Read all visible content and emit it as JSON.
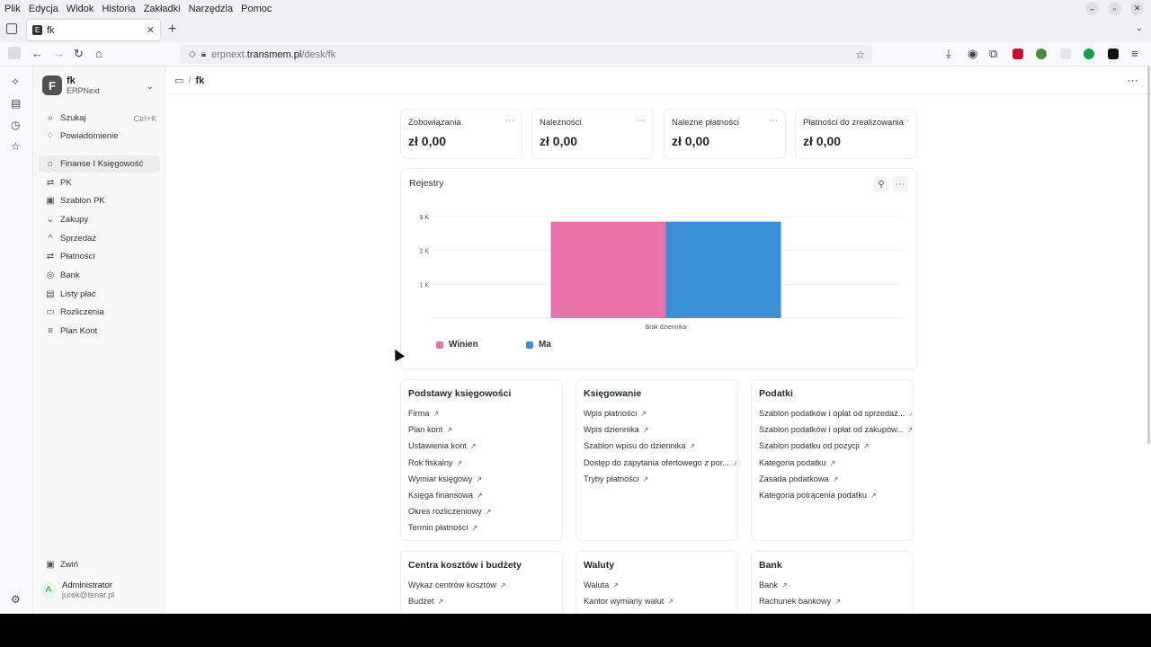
{
  "menubar": [
    "Plik",
    "Edycja",
    "Widok",
    "Historia",
    "Zakładki",
    "Narzędzia",
    "Pomoc"
  ],
  "browser": {
    "tab_title": "fk",
    "url_prefix": "erpnext.",
    "url_domain": "transmem.pl",
    "url_path": "/desk/fk"
  },
  "sidebar": {
    "workspace_name": "fk",
    "workspace_sub": "ERPNext",
    "search_label": "Szukaj",
    "search_shortcut": "Ctrl+K",
    "notifications_label": "Powiadomienie",
    "items": [
      {
        "label": "Finanse I Księgowość",
        "icon": "home-icon",
        "glyph": "⌂",
        "active": true
      },
      {
        "label": "PK",
        "icon": "transfer-icon",
        "glyph": "⇄"
      },
      {
        "label": "Szablon PK",
        "icon": "template-icon",
        "glyph": "▣"
      },
      {
        "label": "Zakupy",
        "icon": "chevron-down-icon",
        "glyph": "⌄"
      },
      {
        "label": "Sprzedaż",
        "icon": "chevron-up-icon",
        "glyph": "^"
      },
      {
        "label": "Płatności",
        "icon": "transfer-icon",
        "glyph": "⇄"
      },
      {
        "label": "Bank",
        "icon": "bank-icon",
        "glyph": "◎"
      },
      {
        "label": "Listy płac",
        "icon": "payroll-icon",
        "glyph": "▤"
      },
      {
        "label": "Rozliczenia",
        "icon": "settlements-icon",
        "glyph": "▭"
      },
      {
        "label": "Plan Kont",
        "icon": "list-icon",
        "glyph": "≡"
      }
    ],
    "collapse_label": "Zwiń",
    "user_initial": "A",
    "user_name": "Administrator",
    "user_email": "jurek@tenar.pl"
  },
  "main": {
    "breadcrumb_current": "fk",
    "number_cards": [
      {
        "label": "Zobowiązania",
        "value": "zł 0,00"
      },
      {
        "label": "Należności",
        "value": "zł 0,00"
      },
      {
        "label": "Należne płatności",
        "value": "zł 0,00"
      },
      {
        "label": "Płatności do zrealizowania",
        "value": "zł 0,00"
      }
    ],
    "chart_title": "Rejestry",
    "link_cards": [
      {
        "title": "Podstawy księgowości",
        "links": [
          "Firma",
          "Plan kont",
          "Ustawienia kont",
          "Rok fiskalny",
          "Wymiar księgowy",
          "Księga finansowa",
          "Okres rozliczeniowy",
          "Termin płatności"
        ]
      },
      {
        "title": "Księgowanie",
        "links": [
          "Wpis płatności",
          "Wpis dziennika",
          "Szablon wpisu do dziennika",
          "Dostęp do zapytania ofertowego z por...",
          "Tryby płatności"
        ]
      },
      {
        "title": "Podatki",
        "links": [
          "Szablon podatków i opłat od sprzedaż...",
          "Szablon podatków i opłat od zakupów...",
          "Szablon podatku od pozycji",
          "Kategoria podatku",
          "Zasada podatkowa",
          "Kategoria potrącenia podatku"
        ]
      },
      {
        "title": "Centra kosztów i budżety",
        "links": [
          "Wykaz centrów kosztów",
          "Budżet"
        ]
      },
      {
        "title": "Waluty",
        "links": [
          "Waluta",
          "Kantor wymiany walut"
        ]
      },
      {
        "title": "Bank",
        "links": [
          "Bank",
          "Rachunek bankowy"
        ]
      }
    ]
  },
  "colors": {
    "winien": "#e872a9",
    "ma": "#3a8fd8"
  },
  "chart_data": {
    "type": "bar",
    "title": "Rejestry",
    "categories": [
      "Brak dziennika"
    ],
    "series": [
      {
        "name": "Winien",
        "values": [
          2850
        ]
      },
      {
        "name": "Ma",
        "values": [
          2850
        ]
      }
    ],
    "ylim": [
      0,
      3000
    ],
    "yticks": [
      "1 K",
      "2 K",
      "3 K"
    ],
    "grid": true,
    "legend": "bottom-left"
  }
}
